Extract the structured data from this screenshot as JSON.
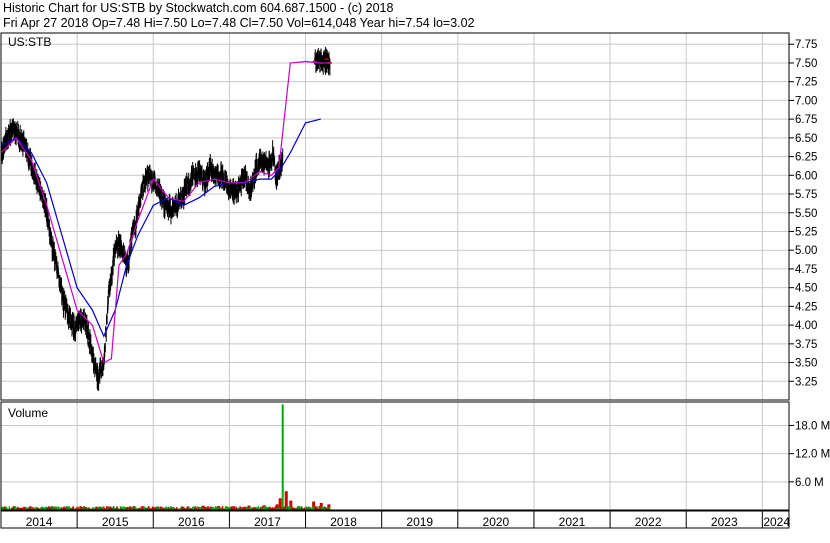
{
  "header": {
    "title_line": "Historic Chart for US:STB by Stockwatch.com 604.687.1500 - (c) 2018",
    "quote_line": "Fri Apr 27 2018  Op=7.48  Hi=7.50  Lo=7.48  Cl=7.50  Vol=614,048  Year hi=7.54  lo=3.02"
  },
  "colors": {
    "price": "#000000",
    "close_marker": "#cc0000",
    "ma_short": "#cc00cc",
    "ma_long": "#0000cc",
    "volume": "#cc0000",
    "volume_spike": "#00aa00",
    "grid": "#c8c8c8",
    "border": "#000000"
  },
  "chart_data": [
    {
      "type": "line",
      "panel": "price",
      "symbol_label": "US:STB",
      "ylim": [
        3.0,
        7.9
      ],
      "y_ticks": [
        "3.25",
        "3.50",
        "3.75",
        "4.00",
        "4.25",
        "4.50",
        "4.75",
        "5.00",
        "5.25",
        "5.50",
        "5.75",
        "6.00",
        "6.25",
        "6.50",
        "6.75",
        "7.00",
        "7.25",
        "7.50",
        "7.75"
      ],
      "x_labels": [
        "2014",
        "2015",
        "2016",
        "2017",
        "2018",
        "2019",
        "2020",
        "2021",
        "2022",
        "2023",
        "2024"
      ],
      "xlim": [
        2014.0,
        2024.35
      ],
      "grid": true,
      "series": [
        {
          "kind": "ohlc",
          "x": [
            2014.0,
            2014.08,
            2014.15,
            2014.22,
            2014.3,
            2014.38,
            2014.45,
            2014.52,
            2014.6,
            2014.68,
            2014.75,
            2014.82,
            2014.9,
            2014.97,
            2015.05,
            2015.12,
            2015.2,
            2015.27,
            2015.35,
            2015.42,
            2015.5,
            2015.57,
            2015.62,
            2015.67,
            2015.72,
            2015.78,
            2015.85,
            2015.92,
            2016.0,
            2016.08,
            2016.15,
            2016.22,
            2016.3,
            2016.38,
            2016.45,
            2016.52,
            2016.6,
            2016.68,
            2016.75,
            2016.82,
            2016.9,
            2016.97,
            2017.05,
            2017.12,
            2017.2,
            2017.27,
            2017.35,
            2017.42,
            2017.5,
            2017.57,
            2017.62,
            2017.66,
            2017.7,
            2018.12,
            2018.2,
            2018.28,
            2018.32
          ],
          "values": [
            6.3,
            6.5,
            6.62,
            6.55,
            6.4,
            6.2,
            6.0,
            5.8,
            5.5,
            5.0,
            4.7,
            4.3,
            4.1,
            3.95,
            4.1,
            4.0,
            3.6,
            3.3,
            3.5,
            4.5,
            5.0,
            5.1,
            4.9,
            4.8,
            5.2,
            5.4,
            5.8,
            6.0,
            5.9,
            5.8,
            5.6,
            5.55,
            5.6,
            5.7,
            5.85,
            6.0,
            6.05,
            5.9,
            6.1,
            5.95,
            6.0,
            5.85,
            5.8,
            5.8,
            6.0,
            5.75,
            6.1,
            6.2,
            6.1,
            6.3,
            5.95,
            6.1,
            6.2,
            7.52,
            7.5,
            7.55,
            7.5
          ],
          "spread": 0.18
        },
        {
          "kind": "ma_short",
          "x": [
            2014.0,
            2014.2,
            2014.4,
            2014.6,
            2014.8,
            2015.0,
            2015.2,
            2015.35,
            2015.45,
            2015.55,
            2015.65,
            2015.8,
            2016.0,
            2016.2,
            2016.4,
            2016.6,
            2016.8,
            2017.0,
            2017.2,
            2017.4,
            2017.55,
            2017.65,
            2017.8,
            2018.0,
            2018.2,
            2018.32
          ],
          "values": [
            6.3,
            6.5,
            6.2,
            5.6,
            4.9,
            4.2,
            4.0,
            3.5,
            3.55,
            4.8,
            4.95,
            5.4,
            5.95,
            5.7,
            5.65,
            5.9,
            5.95,
            5.9,
            5.9,
            6.05,
            6.0,
            6.1,
            7.5,
            7.52,
            7.5,
            7.5
          ]
        },
        {
          "kind": "ma_long",
          "x": [
            2014.0,
            2014.2,
            2014.4,
            2014.6,
            2014.8,
            2015.0,
            2015.2,
            2015.35,
            2015.5,
            2015.65,
            2015.8,
            2016.0,
            2016.2,
            2016.4,
            2016.6,
            2016.8,
            2017.0,
            2017.2,
            2017.4,
            2017.55,
            2017.65,
            2017.8,
            2018.0,
            2018.2
          ],
          "values": [
            6.4,
            6.5,
            6.3,
            5.9,
            5.2,
            4.5,
            4.2,
            3.85,
            4.2,
            4.8,
            5.2,
            5.6,
            5.7,
            5.6,
            5.7,
            5.85,
            5.9,
            5.9,
            5.95,
            5.95,
            6.05,
            6.3,
            6.7,
            6.75
          ]
        }
      ]
    },
    {
      "type": "bar",
      "panel": "volume",
      "panel_label": "Volume",
      "ylim": [
        0,
        23000000
      ],
      "y_ticks": [
        "6.0 M",
        "12.0 M",
        "18.0 M"
      ],
      "y_tick_values": [
        6000000,
        12000000,
        18000000
      ],
      "xlim": [
        2014.0,
        2024.35
      ],
      "x": [
        2014.05,
        2014.25,
        2014.45,
        2014.65,
        2014.85,
        2015.05,
        2015.25,
        2015.45,
        2015.65,
        2015.85,
        2016.05,
        2016.25,
        2016.45,
        2016.65,
        2016.85,
        2017.05,
        2017.25,
        2017.45,
        2017.62,
        2017.66,
        2017.7,
        2017.74,
        2017.8,
        2018.1,
        2018.2,
        2018.3
      ],
      "values": [
        300000,
        350000,
        400000,
        500000,
        450000,
        600000,
        700000,
        550000,
        650000,
        800000,
        700000,
        600000,
        750000,
        900000,
        850000,
        800000,
        950000,
        1000000,
        1200000,
        2500000,
        22500000,
        4000000,
        2000000,
        1800000,
        1500000,
        1200000
      ]
    }
  ]
}
